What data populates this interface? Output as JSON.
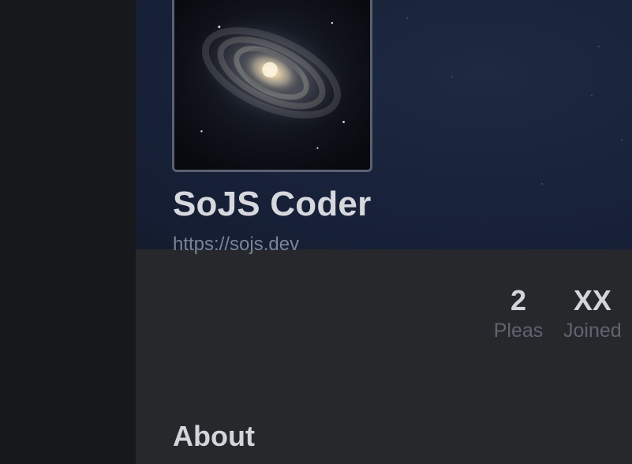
{
  "profile": {
    "name": "SoJS Coder",
    "link": "https://sojs.dev"
  },
  "stats": [
    {
      "value": "2",
      "label": "Pleas"
    },
    {
      "value": "XX",
      "label": "Joined"
    }
  ],
  "sections": {
    "about_title": "About"
  },
  "colors": {
    "page_background": "#26272b",
    "sidebar_background": "#17181c",
    "cover_background": "#18223a",
    "text_primary": "#d6d8de",
    "text_muted": "#5e6470",
    "link_color": "#7a8596"
  }
}
